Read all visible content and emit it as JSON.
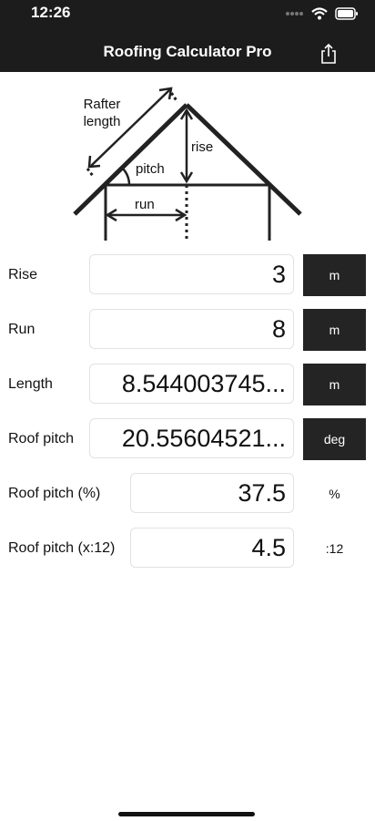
{
  "status_bar": {
    "time": "12:26"
  },
  "nav": {
    "title": "Roofing Calculator Pro"
  },
  "diagram": {
    "rafter_label_1": "Rafter",
    "rafter_label_2": "length",
    "rise_label": "rise",
    "pitch_label": "pitch",
    "run_label": "run"
  },
  "rows": [
    {
      "label": "Rise",
      "value": "3",
      "unit": "m"
    },
    {
      "label": "Run",
      "value": "8",
      "unit": "m"
    },
    {
      "label": "Length",
      "value": "8.544003745...",
      "unit": "m"
    },
    {
      "label": "Roof pitch",
      "value": "20.55604521...",
      "unit": "deg"
    },
    {
      "label": "Roof pitch (%)",
      "value": "37.5",
      "unit": "%"
    },
    {
      "label": "Roof pitch (x:12)",
      "value": "4.5",
      "unit": ":12"
    }
  ]
}
